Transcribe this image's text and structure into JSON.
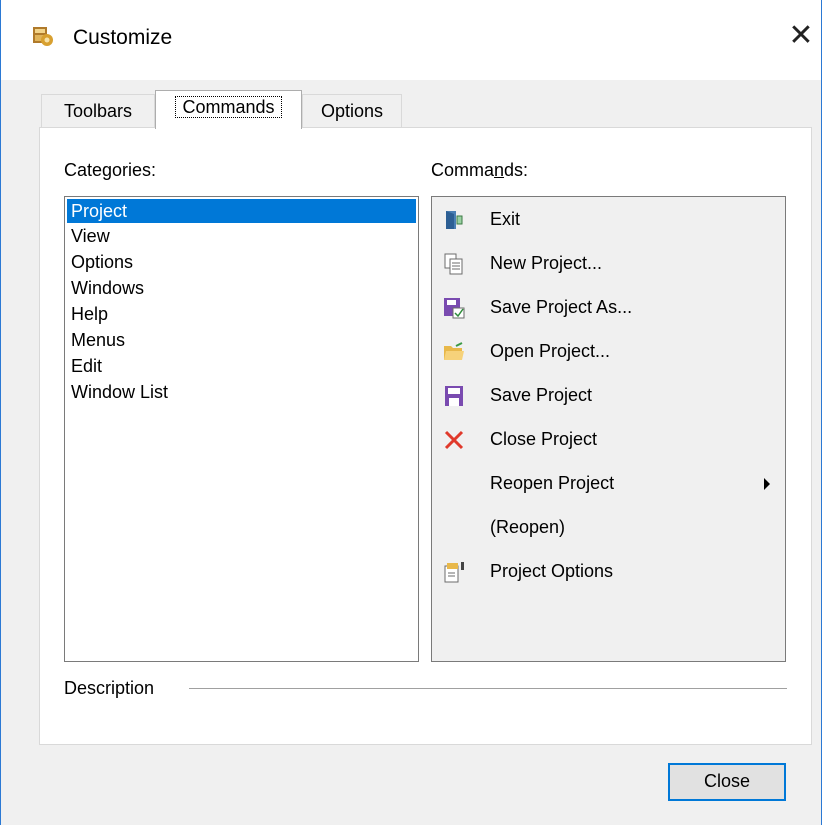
{
  "window": {
    "title": "Customize",
    "close_glyph": "✕"
  },
  "tabs": [
    {
      "label": "Toolbars",
      "active": false
    },
    {
      "label": "Commands",
      "active": true
    },
    {
      "label": "Options",
      "active": false
    }
  ],
  "categories": {
    "label": "Categories:",
    "items": [
      "Project",
      "View",
      "Options",
      "Windows",
      "Help",
      "Menus",
      "Edit",
      "Window List"
    ],
    "selected": "Project"
  },
  "commands": {
    "label_prefix": "Comma",
    "label_underlined": "n",
    "label_suffix": "ds:",
    "items": [
      {
        "label": "Exit",
        "icon": "exit-door-icon"
      },
      {
        "label": "New Project...",
        "icon": "new-document-icon"
      },
      {
        "label": "Save Project As...",
        "icon": "save-as-icon"
      },
      {
        "label": "Open Project...",
        "icon": "open-folder-icon"
      },
      {
        "label": "Save Project",
        "icon": "save-disk-icon"
      },
      {
        "label": "Close Project",
        "icon": "red-x-icon"
      },
      {
        "label": "Reopen Project",
        "icon": "",
        "submenu": true
      },
      {
        "label": "(Reopen)",
        "icon": ""
      },
      {
        "label": "Project Options",
        "icon": "project-options-icon"
      }
    ]
  },
  "description": {
    "label": "Description"
  },
  "buttons": {
    "close_label": "Close"
  },
  "colors": {
    "selection": "#0078d7",
    "window_border": "#2b79d4",
    "close_x": "#e81123"
  }
}
